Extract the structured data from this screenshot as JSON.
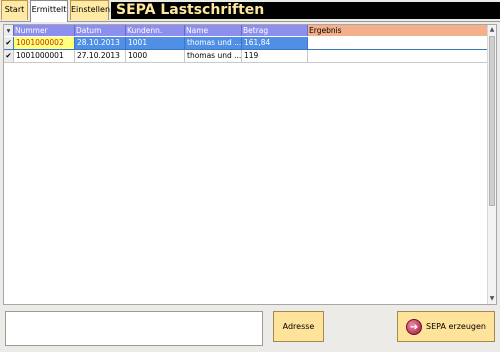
{
  "tabs": [
    "Start",
    "Ermittelt",
    "Einstellen"
  ],
  "title": "SEPA Lastschriften",
  "columns": {
    "sel": "▾",
    "nummer": "Nummer",
    "datum": "Datum",
    "kunden": "Kundenn.",
    "name": "Name",
    "betrag": "Betrag",
    "ergebnis": "Ergebnis"
  },
  "rows": [
    {
      "sel": "✔",
      "nummer": "1001000002",
      "datum": "28.10.2013",
      "kunden": "1001",
      "name": "thomas und ...",
      "betrag": "161,84",
      "ergebnis": ""
    },
    {
      "sel": "✔",
      "nummer": "1001000001",
      "datum": "27.10.2013",
      "kunden": "1000",
      "name": "thomas und ...",
      "betrag": "119",
      "ergebnis": ""
    }
  ],
  "buttons": {
    "adresse": "Adresse",
    "sepa": "SEPA erzeugen"
  },
  "icons": {
    "sepa_arrow": "➔",
    "scroll_up": "▲",
    "scroll_down": "▼"
  },
  "colors": {
    "title_bg": "#000000",
    "title_fg": "#ffe79e",
    "header_bg": "#8d8fee",
    "result_header_bg": "#f3b08a",
    "selected_row": "#4f8fe6",
    "button_bg": "#ffe39a"
  }
}
